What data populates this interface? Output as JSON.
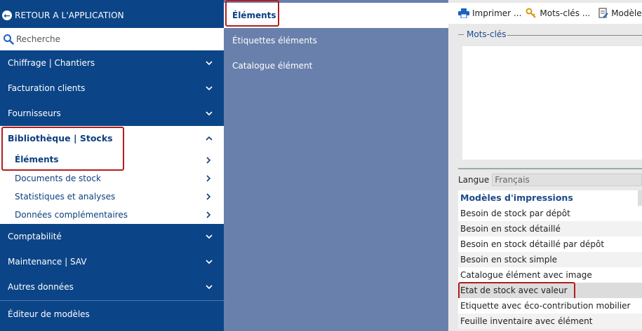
{
  "nav": {
    "back_label": "RETOUR A L'APPLICATION",
    "search_placeholder": "Recherche",
    "items_top": [
      {
        "label": "Chiffrage | Chantiers"
      },
      {
        "label": "Facturation clients"
      },
      {
        "label": "Fournisseurs"
      }
    ],
    "library": {
      "title": "Bibliothèque | Stocks",
      "subitems": [
        {
          "label": "Éléments"
        },
        {
          "label": "Documents de stock"
        },
        {
          "label": "Statistiques et analyses"
        },
        {
          "label": "Données complémentaires"
        }
      ]
    },
    "items_bottom": [
      {
        "label": "Comptabilité"
      },
      {
        "label": "Maintenance | SAV"
      },
      {
        "label": "Autres données"
      }
    ],
    "editor_label": "Éditeur de modèles"
  },
  "middle": {
    "active": "Éléments",
    "items": [
      "Étiquettes éléments",
      "Catalogue élément"
    ]
  },
  "right": {
    "toolbar": {
      "print": "Imprimer ...",
      "keywords": "Mots-clés ...",
      "model": "Modèle p"
    },
    "keywords_legend": "Mots-clés",
    "language_label": "Langue",
    "language_value": "Français",
    "models_header": "Modèles d'impressions",
    "models": [
      "Besoin de stock par dépôt",
      "Besoin en stock détaillé",
      "Besoin en stock détaillé par dépôt",
      "Besoin en stock simple",
      "Catalogue élément avec image",
      "Etat de stock avec valeur",
      "Etiquette avec éco-contribution mobilier",
      "Feuille inventaire avec élément"
    ]
  },
  "colors": {
    "nav_bg": "#0c4587",
    "mid_bg": "#6880ab",
    "highlight": "#b01e1e",
    "link_blue": "#0c3f80"
  }
}
